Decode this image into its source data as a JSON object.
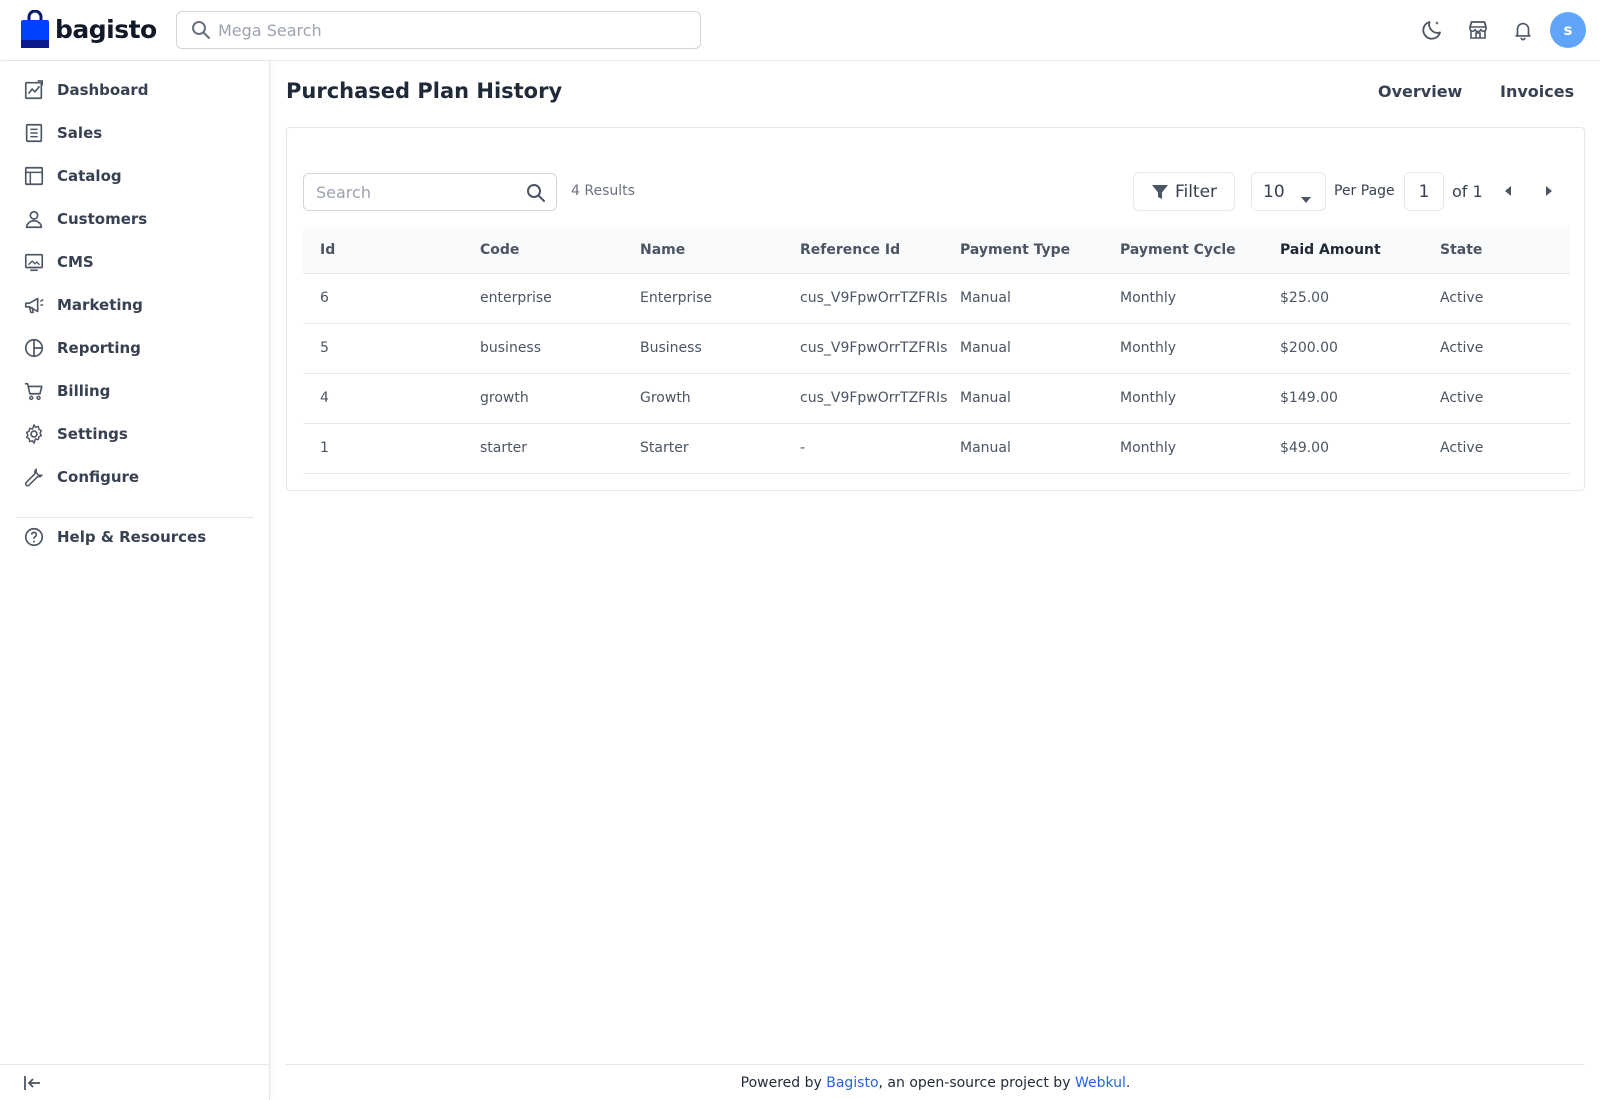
{
  "brand": {
    "name": "bagisto",
    "logo_color": "#0041ff"
  },
  "header": {
    "search_placeholder": "Mega Search",
    "icons": [
      "moon-icon",
      "store-icon",
      "bell-icon"
    ],
    "avatar_initial": "s",
    "avatar_color": "#60a5fa"
  },
  "sidebar": {
    "items": [
      {
        "label": "Dashboard",
        "icon": "dashboard-icon"
      },
      {
        "label": "Sales",
        "icon": "receipt-icon"
      },
      {
        "label": "Catalog",
        "icon": "catalog-icon"
      },
      {
        "label": "Customers",
        "icon": "user-icon"
      },
      {
        "label": "CMS",
        "icon": "monitor-icon"
      },
      {
        "label": "Marketing",
        "icon": "megaphone-icon"
      },
      {
        "label": "Reporting",
        "icon": "pie-chart-icon"
      },
      {
        "label": "Billing",
        "icon": "cart-icon"
      },
      {
        "label": "Settings",
        "icon": "gear-icon"
      },
      {
        "label": "Configure",
        "icon": "wrench-icon"
      }
    ],
    "help": {
      "label": "Help & Resources",
      "icon": "help-circle-icon"
    }
  },
  "page": {
    "title": "Purchased Plan History",
    "tabs": [
      "Overview",
      "Invoices"
    ]
  },
  "datagrid": {
    "search_placeholder": "Search",
    "results_text": "4 Results",
    "filter_label": "Filter",
    "per_page_value": "10",
    "per_page_label": "Per Page",
    "current_page": "1",
    "page_of": "of 1",
    "columns": [
      "Id",
      "Code",
      "Name",
      "Reference Id",
      "Payment Type",
      "Payment Cycle",
      "Paid Amount",
      "State"
    ],
    "rows": [
      [
        "6",
        "enterprise",
        "Enterprise",
        "cus_V9FpwOrrTZFRIs",
        "Manual",
        "Monthly",
        "$25.00",
        "Active"
      ],
      [
        "5",
        "business",
        "Business",
        "cus_V9FpwOrrTZFRIs",
        "Manual",
        "Monthly",
        "$200.00",
        "Active"
      ],
      [
        "4",
        "growth",
        "Growth",
        "cus_V9FpwOrrTZFRIs",
        "Manual",
        "Monthly",
        "$149.00",
        "Active"
      ],
      [
        "1",
        "starter",
        "Starter",
        "-",
        "Manual",
        "Monthly",
        "$49.00",
        "Active"
      ]
    ]
  },
  "footer": {
    "prefix": "Powered by ",
    "link1": "Bagisto",
    "middle": ", an open-source project by ",
    "link2": "Webkul",
    "suffix": ".",
    "link_color": "#2563eb"
  }
}
